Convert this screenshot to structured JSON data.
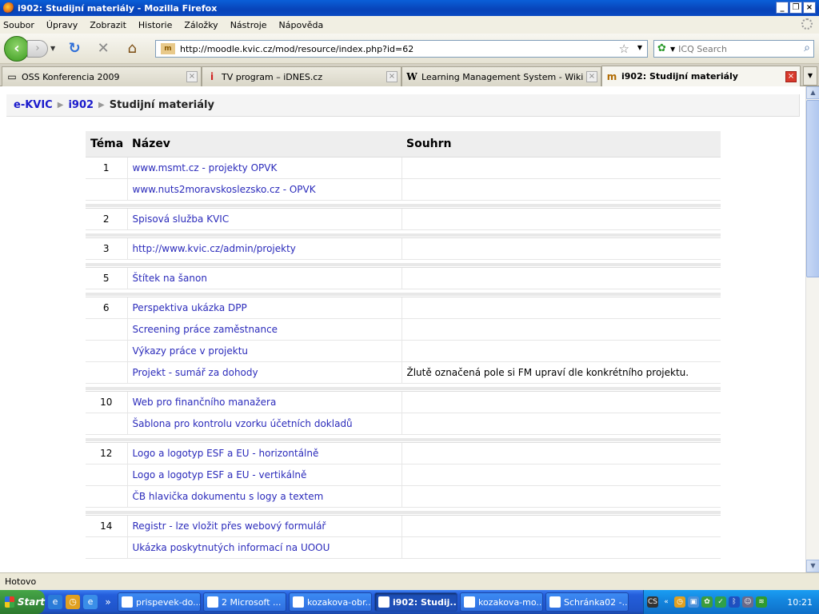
{
  "window": {
    "title": "i902: Studijní materiály - Mozilla Firefox"
  },
  "menu": [
    "Soubor",
    "Úpravy",
    "Zobrazit",
    "Historie",
    "Záložky",
    "Nástroje",
    "Nápověda"
  ],
  "navbar": {
    "url": "http://moodle.kvic.cz/mod/resource/index.php?id=62",
    "search_placeholder": "ICQ Search"
  },
  "tabs": [
    {
      "label": "OSS Konferencia 2009",
      "icon": "page-icon",
      "active": false
    },
    {
      "label": "TV program – iDNES.cz",
      "icon": "idnes-icon",
      "active": false
    },
    {
      "label": "Learning Management System - Wikipe...",
      "icon": "wikipedia-icon",
      "active": false
    },
    {
      "label": "i902: Studijní materiály",
      "icon": "moodle-icon",
      "active": true
    }
  ],
  "breadcrumb": {
    "root": "e-KVIC",
    "course": "i902",
    "current": "Studijní materiály"
  },
  "table": {
    "headers": {
      "tema": "Téma",
      "nazev": "Název",
      "souhrn": "Souhrn"
    },
    "groups": [
      {
        "tema": "1",
        "rows": [
          {
            "nazev": "www.msmt.cz - projekty OPVK",
            "souhrn": ""
          },
          {
            "nazev": "www.nuts2moravskoslezsko.cz - OPVK",
            "souhrn": ""
          }
        ]
      },
      {
        "tema": "2",
        "rows": [
          {
            "nazev": "Spisová služba KVIC",
            "souhrn": ""
          }
        ]
      },
      {
        "tema": "3",
        "rows": [
          {
            "nazev": "http://www.kvic.cz/admin/projekty",
            "souhrn": ""
          }
        ]
      },
      {
        "tema": "5",
        "rows": [
          {
            "nazev": "Štítek na šanon",
            "souhrn": ""
          }
        ]
      },
      {
        "tema": "6",
        "rows": [
          {
            "nazev": "Perspektiva ukázka DPP",
            "souhrn": ""
          },
          {
            "nazev": "Screening práce zaměstnance",
            "souhrn": ""
          },
          {
            "nazev": "Výkazy práce v projektu",
            "souhrn": ""
          },
          {
            "nazev": "Projekt - sumář za dohody",
            "souhrn": "Žlutě označená pole si FM upraví dle konkrétního projektu."
          }
        ]
      },
      {
        "tema": "10",
        "rows": [
          {
            "nazev": "Web pro finančního manažera",
            "souhrn": ""
          },
          {
            "nazev": "Šablona pro kontrolu vzorku účetních dokladů",
            "souhrn": ""
          }
        ]
      },
      {
        "tema": "12",
        "rows": [
          {
            "nazev": "Logo a logotyp ESF a EU - horizontálně",
            "souhrn": ""
          },
          {
            "nazev": "Logo a logotyp ESF a EU - vertikálně",
            "souhrn": ""
          },
          {
            "nazev": "ČB hlavička dokumentu s logy a textem",
            "souhrn": ""
          }
        ]
      },
      {
        "tema": "14",
        "rows": [
          {
            "nazev": "Registr - lze vložit přes webový formulář",
            "souhrn": ""
          },
          {
            "nazev": "Ukázka poskytnutých informací na UOOU",
            "souhrn": ""
          }
        ]
      }
    ]
  },
  "status": "Hotovo",
  "taskbar": {
    "start": "Start",
    "tasks": [
      {
        "label": "prispevek-do...",
        "icon": "word-icon",
        "active": false
      },
      {
        "label": "2 Microsoft ...",
        "icon": "outlook-icon",
        "active": false
      },
      {
        "label": "kozakova-obr...",
        "icon": "folder-icon",
        "active": false
      },
      {
        "label": "i902: Studij...",
        "icon": "firefox-icon",
        "active": true
      },
      {
        "label": "kozakova-mo...",
        "icon": "document-icon",
        "active": false
      },
      {
        "label": "Schránka02 -...",
        "icon": "paint-icon",
        "active": false
      }
    ],
    "clock": "10:21"
  }
}
